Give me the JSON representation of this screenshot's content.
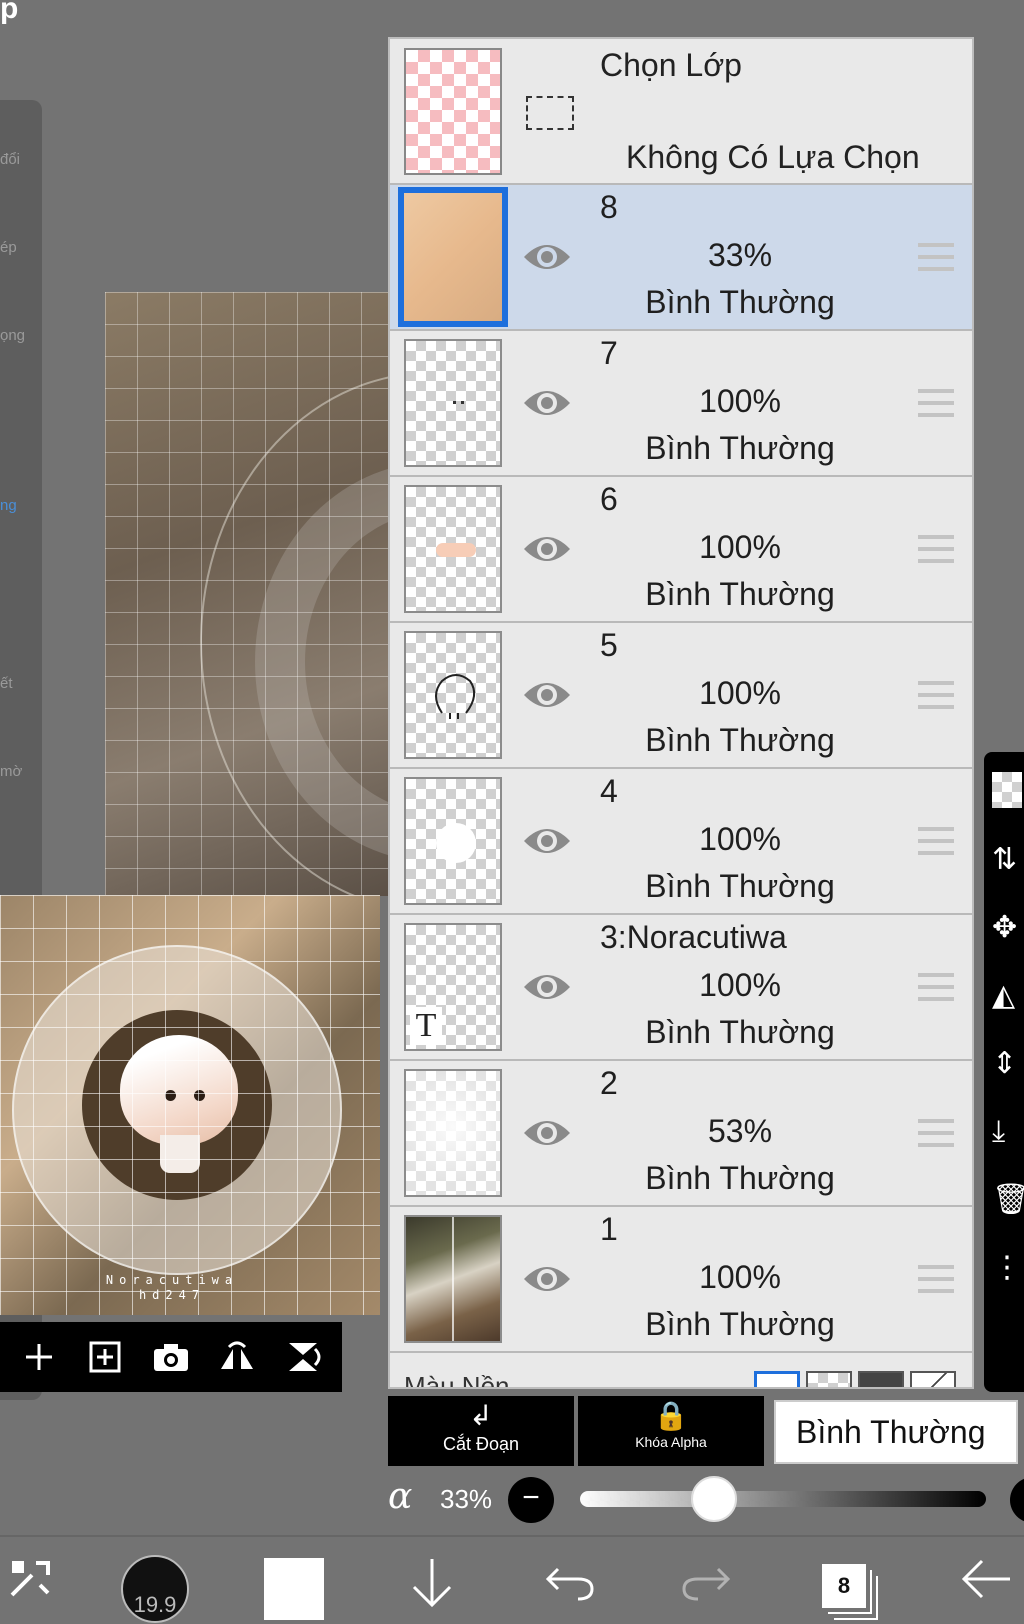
{
  "top_letter": "p",
  "left_tools": [
    {
      "icon": "arrow-icon",
      "label": "đổi"
    },
    {
      "icon": "pen-icon",
      "label": "ép"
    },
    {
      "icon": "circle-icon",
      "label": "ọng"
    },
    {
      "icon": "blur-icon",
      "label": ""
    },
    {
      "icon": "brush-icon",
      "label": "ng"
    },
    {
      "icon": "bucket-icon",
      "label": ""
    },
    {
      "icon": "smudge-icon",
      "label": "ết"
    },
    {
      "icon": "eraser-icon",
      "label": "mờ"
    }
  ],
  "preview_signature": "Noracutiwa hd247",
  "layer_panel": {
    "selection": {
      "title": "Chọn Lớp",
      "status": "Không Có Lựa Chọn"
    },
    "layers": [
      {
        "name": "8",
        "opacity": "33%",
        "blend": "Bình Thường",
        "selected": true
      },
      {
        "name": "7",
        "opacity": "100%",
        "blend": "Bình Thường",
        "selected": false
      },
      {
        "name": "6",
        "opacity": "100%",
        "blend": "Bình Thường",
        "selected": false
      },
      {
        "name": "5",
        "opacity": "100%",
        "blend": "Bình Thường",
        "selected": false
      },
      {
        "name": "4",
        "opacity": "100%",
        "blend": "Bình Thường",
        "selected": false
      },
      {
        "name": "3:Noracutiwa",
        "opacity": "100%",
        "blend": "Bình Thường",
        "selected": false,
        "text_badge": "T"
      },
      {
        "name": "2",
        "opacity": "53%",
        "blend": "Bình Thường",
        "selected": false
      },
      {
        "name": "1",
        "opacity": "100%",
        "blend": "Bình Thường",
        "selected": false
      }
    ],
    "background_label": "Màu Nền"
  },
  "actions": {
    "clip": {
      "icon": "clip-arrow-icon",
      "label": "Cắt Đoạn"
    },
    "alpha_lock": {
      "icon": "lock-alpha-icon",
      "label": "Khóa Alpha"
    },
    "blend_mode": "Bình Thường"
  },
  "opacity": {
    "symbol": "α",
    "value": "33%",
    "minus": "−",
    "level": 0.33
  },
  "bottom_nav": {
    "brush_size": "19.9",
    "layer_count": "8"
  },
  "colors": {
    "selected_row": "#cdd9ea",
    "selection_border": "#1e6fdc",
    "panel_bg": "#e9e9e9",
    "screen_bg": "#737373"
  }
}
